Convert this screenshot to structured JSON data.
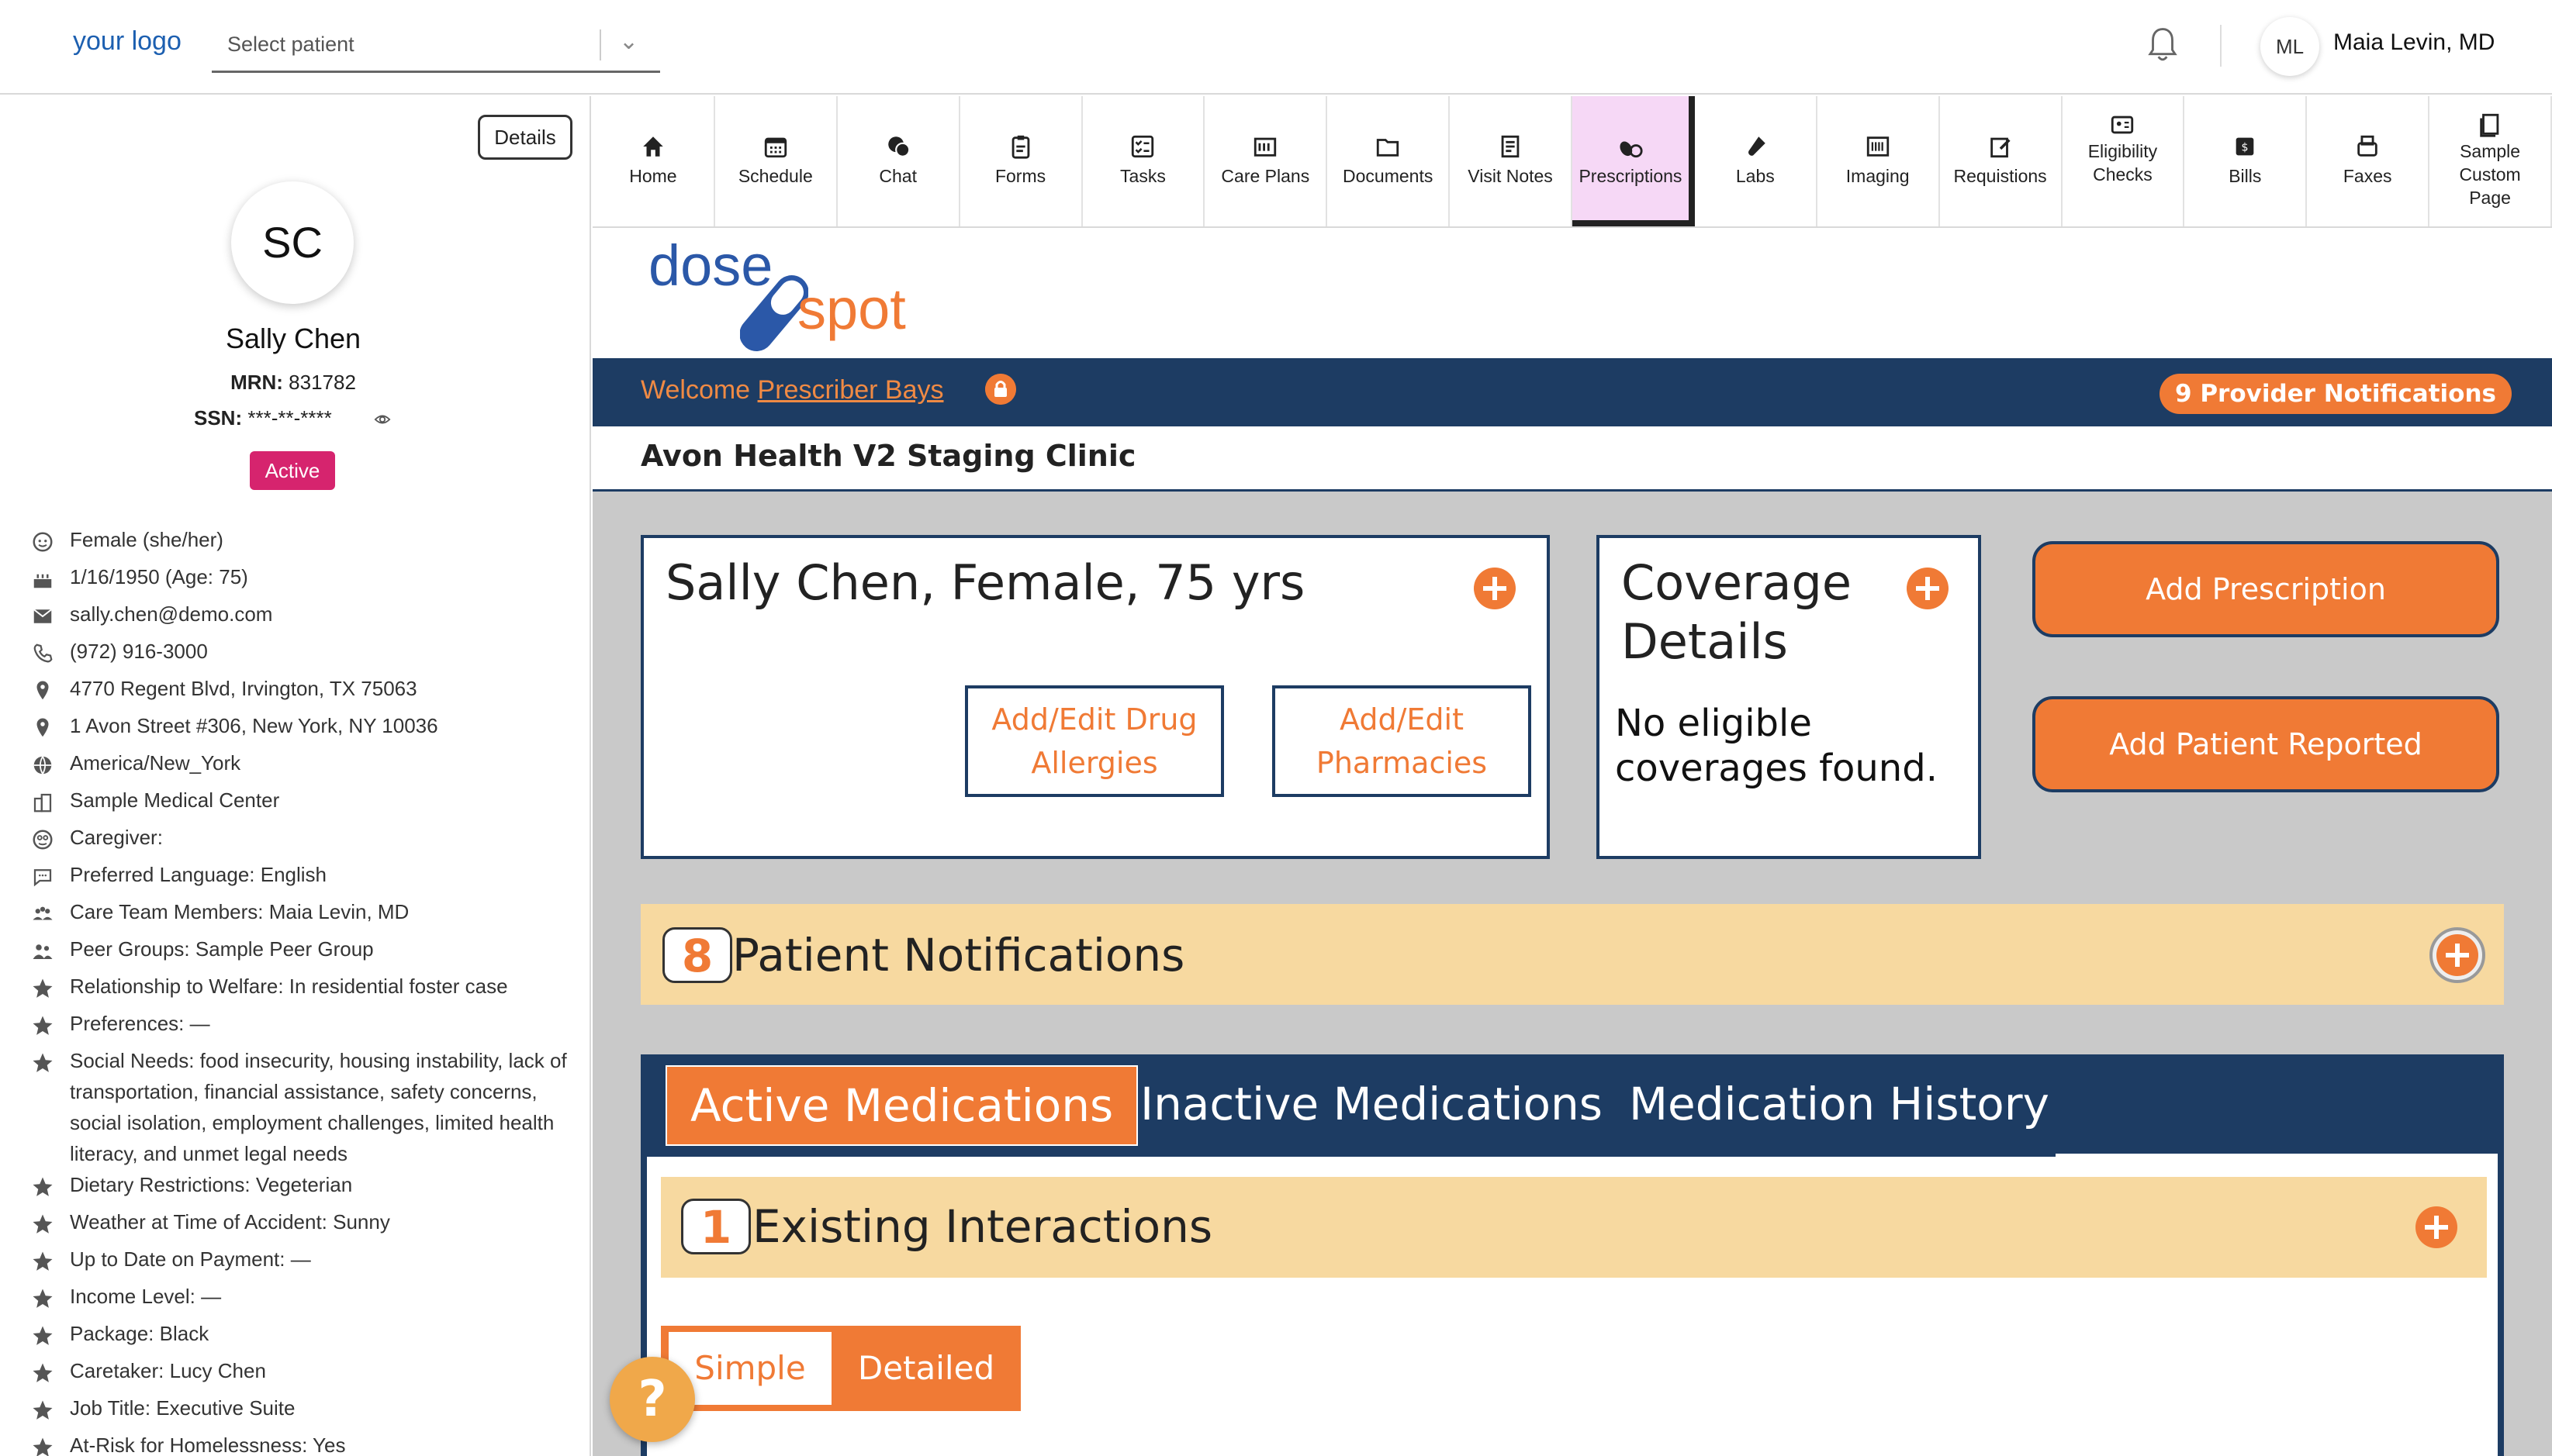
{
  "topbar": {
    "logo": "your logo",
    "patient_select_placeholder": "Select patient",
    "user_initials": "ML",
    "user_name": "Maia Levin, MD"
  },
  "sidebar": {
    "details_label": "Details",
    "initials": "SC",
    "name": "Sally Chen",
    "mrn_label": "MRN:",
    "mrn": "831782",
    "ssn_label": "SSN:",
    "ssn": "***-**-****",
    "status": "Active",
    "info": [
      {
        "icon": "person-icon",
        "text": "Female (she/her)"
      },
      {
        "icon": "cake-icon",
        "text": "1/16/1950 (Age: 75)"
      },
      {
        "icon": "mail-icon",
        "text": "sally.chen@demo.com"
      },
      {
        "icon": "phone-icon",
        "text": "(972) 916-3000"
      },
      {
        "icon": "location-pin-icon",
        "text": "4770 Regent Blvd, Irvington, TX 75063"
      },
      {
        "icon": "location-pin-icon",
        "text": "1 Avon Street #306, New York, NY 10036"
      },
      {
        "icon": "globe-icon",
        "text": "America/New_York"
      },
      {
        "icon": "building-icon",
        "text": "Sample Medical Center"
      },
      {
        "icon": "caregiver-icon",
        "text": "Caregiver:"
      },
      {
        "icon": "chat-bubble-icon",
        "text": "Preferred Language: English"
      },
      {
        "icon": "team-icon",
        "text": "Care Team Members: Maia Levin, MD"
      },
      {
        "icon": "group-icon",
        "text": "Peer Groups: Sample Peer Group"
      },
      {
        "icon": "star-icon",
        "text": "Relationship to Welfare: In residential foster case"
      },
      {
        "icon": "star-icon",
        "text": "Preferences: —"
      },
      {
        "icon": "star-icon",
        "text": "Social Needs: food insecurity, housing instability, lack of transportation, financial assistance, safety concerns, social isolation, employment challenges, limited health literacy, and unmet legal needs"
      },
      {
        "icon": "star-icon",
        "text": "Dietary Restrictions: Vegeterian"
      },
      {
        "icon": "star-icon",
        "text": "Weather at Time of Accident: Sunny"
      },
      {
        "icon": "star-icon",
        "text": "Up to Date on Payment: —"
      },
      {
        "icon": "star-icon",
        "text": "Income Level: —"
      },
      {
        "icon": "star-icon",
        "text": "Package: Black"
      },
      {
        "icon": "star-icon",
        "text": "Caretaker: Lucy Chen"
      },
      {
        "icon": "star-icon",
        "text": "Job Title: Executive Suite"
      },
      {
        "icon": "star-icon",
        "text": "At-Risk for Homelessness: Yes"
      }
    ]
  },
  "nav": {
    "tabs": [
      {
        "label": "Home",
        "icon": "home-icon"
      },
      {
        "label": "Schedule",
        "icon": "calendar-icon"
      },
      {
        "label": "Chat",
        "icon": "chat-icon"
      },
      {
        "label": "Forms",
        "icon": "clipboard-icon"
      },
      {
        "label": "Tasks",
        "icon": "checklist-icon"
      },
      {
        "label": "Care Plans",
        "icon": "care-plan-icon"
      },
      {
        "label": "Documents",
        "icon": "folder-icon"
      },
      {
        "label": "Visit Notes",
        "icon": "notes-icon"
      },
      {
        "label": "Prescriptions",
        "icon": "pills-icon",
        "active": true
      },
      {
        "label": "Labs",
        "icon": "test-tube-icon"
      },
      {
        "label": "Imaging",
        "icon": "imaging-icon"
      },
      {
        "label": "Requistions",
        "icon": "requisition-icon"
      },
      {
        "label": "Eligibility Checks",
        "icon": "id-card-icon"
      },
      {
        "label": "Bills",
        "icon": "bill-icon"
      },
      {
        "label": "Faxes",
        "icon": "fax-icon"
      },
      {
        "label": "Sample Custom Page",
        "icon": "page-icon"
      }
    ]
  },
  "dosespot": {
    "logo_dose": "dose",
    "logo_spot": "spot",
    "welcome_prefix": "Welcome",
    "prescriber": "Prescriber Bays",
    "provider_notifications": "9 Provider Notifications",
    "clinic": "Avon Health V2 Staging Clinic",
    "patient_card_title": "Sally Chen, Female, 75 yrs",
    "allergies_btn": "Add/Edit Drug Allergies",
    "pharmacies_btn": "Add/Edit Pharmacies",
    "coverage_title": "Coverage Details",
    "coverage_text": "No eligible coverages found.",
    "add_prescription": "Add Prescription",
    "add_patient_reported": "Add Patient Reported",
    "patient_notifications_count": "8",
    "patient_notifications_label": "Patient Notifications",
    "med_tabs": [
      "Active Medications",
      "Inactive Medications",
      "Medication History"
    ],
    "interactions_count": "1",
    "interactions_label": "Existing Interactions",
    "toggle_simple": "Simple",
    "toggle_detailed": "Detailed",
    "help": "?"
  },
  "colors": {
    "accent": "#f07a35",
    "navy": "#1d3c63",
    "notification_bg": "#f7d9a0",
    "status_badge": "#d6246e",
    "active_tab": "#f6d8f6"
  }
}
